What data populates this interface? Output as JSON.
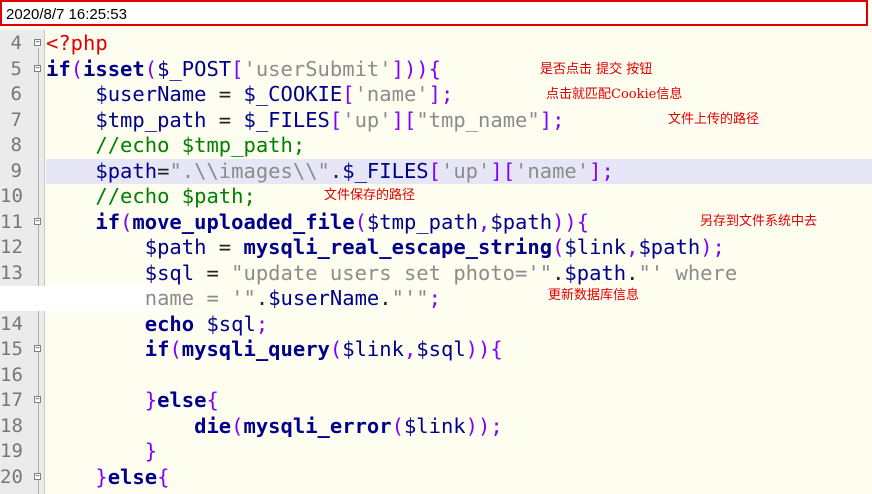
{
  "titlebar": {
    "timestamp": "2020/8/7 16:25:53"
  },
  "lines": [
    {
      "num": "4",
      "fold": "minus",
      "tokens": [
        [
          "tag",
          "<?php"
        ]
      ]
    },
    {
      "num": "5",
      "fold": "minus",
      "tokens": [
        [
          "kw",
          "if"
        ],
        [
          "punc",
          "("
        ],
        [
          "kw",
          "isset"
        ],
        [
          "punc",
          "("
        ],
        [
          "var",
          "$_POST"
        ],
        [
          "punc",
          "["
        ],
        [
          "str",
          "'userSubmit'"
        ],
        [
          "punc",
          "]))"
        ],
        [
          "punc",
          "{"
        ]
      ]
    },
    {
      "num": "6",
      "tokens": [
        [
          "plain",
          "    "
        ],
        [
          "var",
          "$userName"
        ],
        [
          "plain",
          " = "
        ],
        [
          "var",
          "$_COOKIE"
        ],
        [
          "punc",
          "["
        ],
        [
          "str",
          "'name'"
        ],
        [
          "punc",
          "];"
        ]
      ]
    },
    {
      "num": "7",
      "tokens": [
        [
          "plain",
          "    "
        ],
        [
          "var",
          "$tmp_path"
        ],
        [
          "plain",
          " = "
        ],
        [
          "var",
          "$_FILES"
        ],
        [
          "punc",
          "["
        ],
        [
          "str",
          "'up'"
        ],
        [
          "punc",
          "]["
        ],
        [
          "str",
          "\"tmp_name\""
        ],
        [
          "punc",
          "];"
        ]
      ]
    },
    {
      "num": "8",
      "tokens": [
        [
          "plain",
          "    "
        ],
        [
          "cmt",
          "//echo $tmp_path;"
        ]
      ]
    },
    {
      "num": "9",
      "highlight": true,
      "tokens": [
        [
          "plain",
          "    "
        ],
        [
          "var",
          "$path"
        ],
        [
          "plain",
          "="
        ],
        [
          "str",
          "\".\\\\images\\\\\""
        ],
        [
          "plain",
          "."
        ],
        [
          "var",
          "$_FILES"
        ],
        [
          "punc",
          "["
        ],
        [
          "str",
          "'up'"
        ],
        [
          "punc",
          "]["
        ],
        [
          "str",
          "'name'"
        ],
        [
          "punc",
          "];"
        ]
      ]
    },
    {
      "num": "10",
      "tokens": [
        [
          "plain",
          "    "
        ],
        [
          "cmt",
          "//echo $path;"
        ]
      ]
    },
    {
      "num": "11",
      "fold": "minus",
      "tokens": [
        [
          "plain",
          "    "
        ],
        [
          "kw",
          "if"
        ],
        [
          "punc",
          "("
        ],
        [
          "fn",
          "move_uploaded_file"
        ],
        [
          "punc",
          "("
        ],
        [
          "var",
          "$tmp_path"
        ],
        [
          "punc",
          ","
        ],
        [
          "var",
          "$path"
        ],
        [
          "punc",
          "))"
        ],
        [
          "punc",
          "{"
        ]
      ]
    },
    {
      "num": "12",
      "tokens": [
        [
          "plain",
          "        "
        ],
        [
          "var",
          "$path"
        ],
        [
          "plain",
          " = "
        ],
        [
          "fn",
          "mysqli_real_escape_string"
        ],
        [
          "punc",
          "("
        ],
        [
          "var",
          "$link"
        ],
        [
          "punc",
          ","
        ],
        [
          "var",
          "$path"
        ],
        [
          "punc",
          ");"
        ]
      ]
    },
    {
      "num": "13",
      "tokens": [
        [
          "plain",
          "        "
        ],
        [
          "var",
          "$sql"
        ],
        [
          "plain",
          " = "
        ],
        [
          "str",
          "\"update users set photo='\""
        ],
        [
          "plain",
          "."
        ],
        [
          "var",
          "$path"
        ],
        [
          "plain",
          "."
        ],
        [
          "str",
          "\"' where"
        ]
      ]
    },
    {
      "num": "",
      "wrap": true,
      "tokens": [
        [
          "plain",
          "        "
        ],
        [
          "str",
          "name = '\""
        ],
        [
          "plain",
          "."
        ],
        [
          "var",
          "$userName"
        ],
        [
          "plain",
          "."
        ],
        [
          "str",
          "\"'\""
        ],
        [
          "punc",
          ";"
        ]
      ]
    },
    {
      "num": "14",
      "tokens": [
        [
          "plain",
          "        "
        ],
        [
          "kw",
          "echo"
        ],
        [
          "plain",
          " "
        ],
        [
          "var",
          "$sql"
        ],
        [
          "punc",
          ";"
        ]
      ]
    },
    {
      "num": "15",
      "fold": "minus",
      "tokens": [
        [
          "plain",
          "        "
        ],
        [
          "kw",
          "if"
        ],
        [
          "punc",
          "("
        ],
        [
          "fn",
          "mysqli_query"
        ],
        [
          "punc",
          "("
        ],
        [
          "var",
          "$link"
        ],
        [
          "punc",
          ","
        ],
        [
          "var",
          "$sql"
        ],
        [
          "punc",
          "))"
        ],
        [
          "punc",
          "{"
        ]
      ]
    },
    {
      "num": "16",
      "tokens": [
        [
          "plain",
          ""
        ]
      ]
    },
    {
      "num": "17",
      "fold": "minus",
      "tokens": [
        [
          "plain",
          "        "
        ],
        [
          "punc",
          "}"
        ],
        [
          "kw",
          "else"
        ],
        [
          "punc",
          "{"
        ]
      ]
    },
    {
      "num": "18",
      "tokens": [
        [
          "plain",
          "            "
        ],
        [
          "fn",
          "die"
        ],
        [
          "punc",
          "("
        ],
        [
          "fn",
          "mysqli_error"
        ],
        [
          "punc",
          "("
        ],
        [
          "var",
          "$link"
        ],
        [
          "punc",
          "));"
        ]
      ]
    },
    {
      "num": "19",
      "tokens": [
        [
          "plain",
          "        "
        ],
        [
          "punc",
          "}"
        ]
      ]
    },
    {
      "num": "20",
      "fold": "minus",
      "tokens": [
        [
          "plain",
          "    "
        ],
        [
          "punc",
          "}"
        ],
        [
          "kw",
          "else"
        ],
        [
          "punc",
          "{"
        ]
      ]
    }
  ],
  "annotations": {
    "a1": "是否点击 提交 按钮",
    "a2": "点击就匹配Cookie信息",
    "a3": "文件上传的路径",
    "a4": "文件保存的路径",
    "a5": "另存到文件系统中去",
    "a6": "更新数据库信息"
  },
  "colors": {
    "keyword": "#00008b",
    "string": "#8c8c8c",
    "comment": "#008000",
    "php_tag": "#e00000",
    "operator": "#8000ff",
    "annotation": "#e00000",
    "highlight_line": "#e6e6f6",
    "background": "#fdfdf0"
  }
}
